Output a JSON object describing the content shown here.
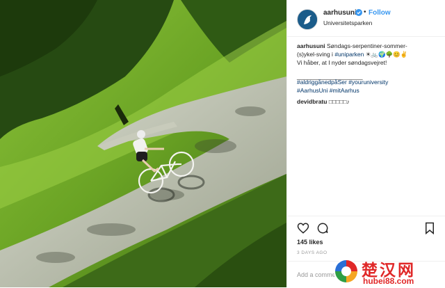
{
  "post": {
    "account": {
      "username": "aarhusuni",
      "verified_icon": "verified-badge-icon",
      "separator": "•",
      "follow_label": "Follow",
      "location": "Universitetsparken"
    },
    "caption": {
      "username": "aarhusuni",
      "line1": "Søndags-serpentiner-sommer-",
      "line2_prefix": "(s)ykel-sving i ",
      "line2_tag": "#uniparken",
      "line2_emoji": "☀🚲🌍🌳😊✌",
      "line3": "Vi håber, at I nyder søndagsvejret!",
      "separator_line": "____________________",
      "hashtags_line1": "#aldriggånedpåSer #youruniversity",
      "hashtags_line2": "#AarhusUni #mitAarhus"
    },
    "comments": [
      {
        "username": "devidbratu",
        "text": "□□□□□♪"
      }
    ],
    "actions": {
      "like_icon": "heart-icon",
      "comment_icon": "comment-icon",
      "save_icon": "bookmark-icon"
    },
    "likes_label": "145 likes",
    "time_ago": "3 DAYS AGO",
    "add_comment_placeholder": "Add a comment..."
  },
  "watermark": {
    "title": "楚汉网",
    "url": "hubei88.com"
  },
  "colors": {
    "follow_blue": "#3897f0",
    "hashtag_blue": "#003569",
    "watermark_red": "#e02828",
    "grass_green": "#6aa324"
  }
}
